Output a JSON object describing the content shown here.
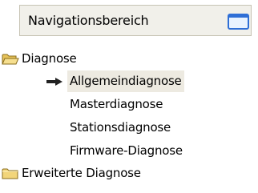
{
  "panel": {
    "title": "Navigationsbereich",
    "toggle_icon": "window-icon"
  },
  "tree": {
    "root_label": "Diagnose",
    "root_icon": "folder-open-icon",
    "children": [
      {
        "label": "Allgemeindiagnose",
        "selected": true
      },
      {
        "label": "Masterdiagnose",
        "selected": false
      },
      {
        "label": "Stationsdiagnose",
        "selected": false
      },
      {
        "label": "Firmware-Diagnose",
        "selected": false
      }
    ],
    "selection_icon": "arrow-right-icon",
    "extended_label": "Erweiterte Diagnose",
    "extended_icon": "folder-closed-icon"
  },
  "colors": {
    "header_bg": "#f1f0ea",
    "selection_bg": "#edeae1",
    "folder_yellow": "#f2d57a",
    "accent_blue": "#2f6fd6"
  }
}
